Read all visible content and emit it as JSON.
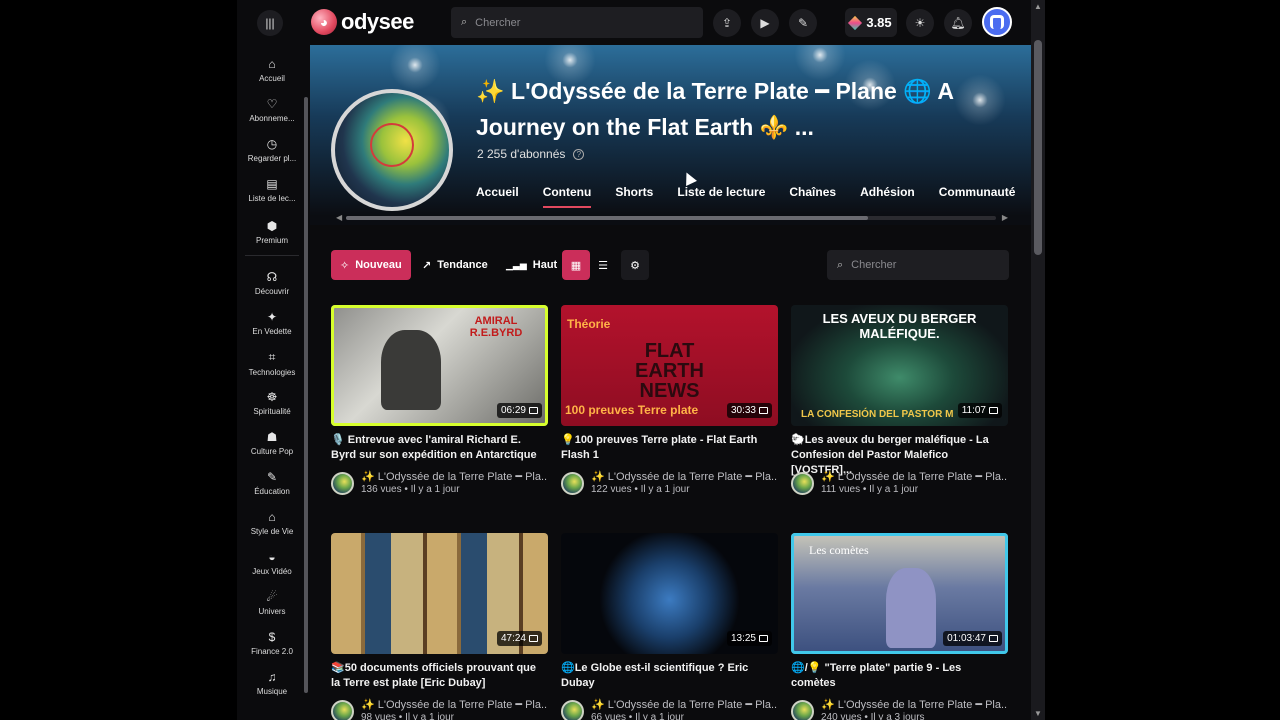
{
  "header": {
    "logo_text": "odysee",
    "search_placeholder": "Chercher",
    "credits": "3.85"
  },
  "sidebar": {
    "items": [
      {
        "label": "Accueil",
        "icon": "home-icon",
        "glyph": "⌂"
      },
      {
        "label": "Abonneme...",
        "icon": "heart-icon",
        "glyph": "♡"
      },
      {
        "label": "Regarder pl...",
        "icon": "clock-icon",
        "glyph": "◷"
      },
      {
        "label": "Liste de lec...",
        "icon": "playlist-icon",
        "glyph": "▤"
      },
      {
        "label": "Premium",
        "icon": "premium-icon",
        "glyph": "⬢"
      },
      {
        "label": "Découvrir",
        "icon": "discover-icon",
        "glyph": "☊"
      },
      {
        "label": "En Vedette",
        "icon": "sparkle-icon",
        "glyph": "✦"
      },
      {
        "label": "Technologies",
        "icon": "chip-icon",
        "glyph": "⌗"
      },
      {
        "label": "Spiritualité",
        "icon": "spirituality-icon",
        "glyph": "☸"
      },
      {
        "label": "Culture Pop",
        "icon": "mask-icon",
        "glyph": "☗"
      },
      {
        "label": "Éducation",
        "icon": "graduation-icon",
        "glyph": "✎"
      },
      {
        "label": "Style de Vie",
        "icon": "lifestyle-icon",
        "glyph": "⌂"
      },
      {
        "label": "Jeux Vidéo",
        "icon": "gamepad-icon",
        "glyph": "◒"
      },
      {
        "label": "Univers",
        "icon": "planet-icon",
        "glyph": "☄"
      },
      {
        "label": "Finance 2.0",
        "icon": "dollar-icon",
        "glyph": "$"
      },
      {
        "label": "Musique",
        "icon": "music-icon",
        "glyph": "♫"
      }
    ]
  },
  "channel": {
    "title": "✨ L'Odyssée de la Terre Plate ━ Plane 🌐 A Journey on the Flat Earth ⚜️ ...",
    "subscribers": "2 255 d'abonnés",
    "tabs": [
      "Accueil",
      "Contenu",
      "Shorts",
      "Liste de lecture",
      "Chaînes",
      "Adhésion",
      "Communauté"
    ],
    "active_tab": "Contenu"
  },
  "filters": {
    "new": "Nouveau",
    "trending": "Tendance",
    "top": "Haut",
    "search_placeholder": "Chercher"
  },
  "videos": [
    {
      "title": "🎙️ Entrevue avec l'amiral Richard E. Byrd sur son expédition en Antarctique",
      "duration": "06:29",
      "channel": "✨ L'Odyssée de la Terre Plate ━ Pla...",
      "meta": "136 vues • Il y a 1 jour",
      "thumb_text": "AMIRAL R.E.BYRD"
    },
    {
      "title": "💡100 preuves Terre plate - Flat Earth Flash 1",
      "duration": "30:33",
      "channel": "✨ L'Odyssée de la Terre Plate ━ Pla...",
      "meta": "122 vues • Il y a 1 jour",
      "thumb_text": "Théorie",
      "thumb_text2": "FLAT EARTH NEWS",
      "thumb_text3": "100 preuves Terre plate"
    },
    {
      "title": "🐑Les aveux du berger maléfique - La Confesion del Pastor Malefico [VOSTFR]...",
      "duration": "11:07",
      "channel": "✨ L'Odyssée de la Terre Plate ━ Pla...",
      "meta": "111 vues • Il y a 1 jour",
      "thumb_text": "LES AVEUX DU BERGER MALÉFIQUE.",
      "thumb_text2": "LA CONFESIÓN DEL PASTOR M"
    },
    {
      "title": "📚50 documents officiels prouvant que la Terre est plate [Eric Dubay]",
      "duration": "47:24",
      "channel": "✨ L'Odyssée de la Terre Plate ━ Pla...",
      "meta": "98 vues • Il y a 1 jour",
      "thumb_text": ""
    },
    {
      "title": "🌐Le Globe est-il scientifique ? Eric Dubay",
      "duration": "13:25",
      "channel": "✨ L'Odyssée de la Terre Plate ━ Pla...",
      "meta": "66 vues • Il y a 1 jour",
      "thumb_text": ""
    },
    {
      "title": "🌐/💡 \"Terre plate\" partie 9 - Les comètes",
      "duration": "01:03:47",
      "channel": "✨ L'Odyssée de la Terre Plate ━ Pla...",
      "meta": "240 vues • Il y a 3 jours",
      "thumb_text": "Les comètes"
    }
  ],
  "colors": {
    "accent": "#cb2e5a",
    "highlight_yellow": "#d7ff2d",
    "highlight_cyan": "#41c8ea"
  }
}
